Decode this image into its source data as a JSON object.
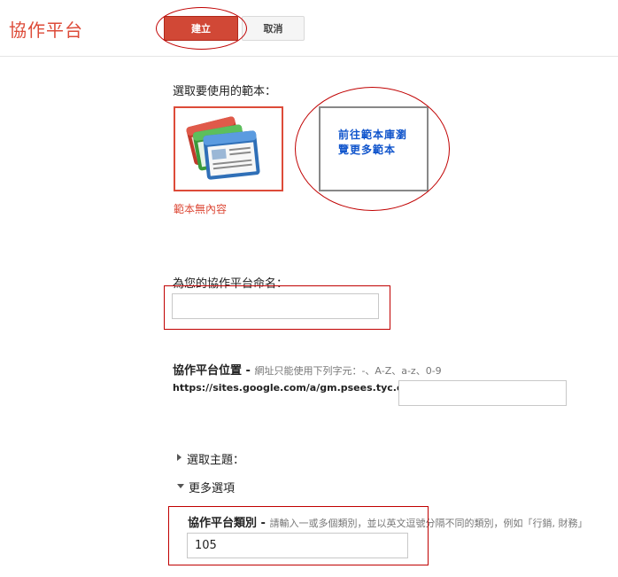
{
  "header": {
    "title": "協作平台",
    "create_label": "建立",
    "cancel_label": "取消"
  },
  "template": {
    "heading": "選取要使用的範本：",
    "blank_label": "範本無內容",
    "gallery_link": "前往範本庫瀏覽更多範本"
  },
  "site_name": {
    "label": "為您的協作平台命名：",
    "value": ""
  },
  "location": {
    "label": "協作平台位置",
    "separator": " - ",
    "hint": "網址只能使用下列字元：-、A-Z、a-z、0-9",
    "url_prefix": "https://sites.google.com/a/gm.psees.tyc.edu.tw/",
    "value": ""
  },
  "theme": {
    "label": "選取主題："
  },
  "more_options": {
    "label": "更多選項"
  },
  "category": {
    "label": "協作平台類別",
    "separator": " - ",
    "hint": "請輸入一或多個類別，並以英文逗號分隔不同的類別，例如「行銷, 財務」",
    "value": "105"
  },
  "colors": {
    "accent": "#dd4b39",
    "annotation": "#c00000",
    "link": "#1155cc"
  }
}
